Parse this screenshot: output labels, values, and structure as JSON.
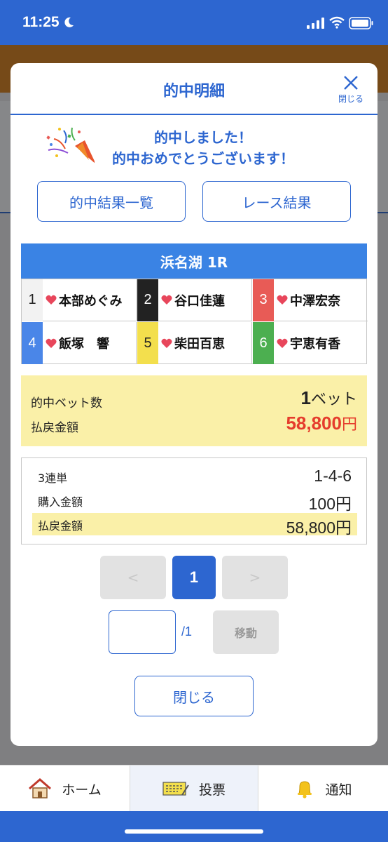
{
  "status_bar": {
    "time": "11:25"
  },
  "modal": {
    "title": "的中明細",
    "close_label": "閉じる",
    "congrats_line1": "的中しました！",
    "congrats_line2": "的中おめでとうございます！",
    "btn_results_list": "的中結果一覧",
    "btn_race_result": "レース結果",
    "race_title": "浜名湖 1R",
    "racers": [
      {
        "num": "1",
        "name": "本部めぐみ",
        "color": "#f2f2f2",
        "text_color": "#222"
      },
      {
        "num": "2",
        "name": "谷口佳蓮",
        "color": "#222222",
        "text_color": "#fff"
      },
      {
        "num": "3",
        "name": "中澤宏奈",
        "color": "#e85b56",
        "text_color": "#fff"
      },
      {
        "num": "4",
        "name": "飯塚　響",
        "color": "#4a86e8",
        "text_color": "#fff"
      },
      {
        "num": "5",
        "name": "柴田百恵",
        "color": "#f3df4d",
        "text_color": "#222"
      },
      {
        "num": "6",
        "name": "宇恵有香",
        "color": "#4caf50",
        "text_color": "#fff"
      }
    ],
    "summary": {
      "bets_label": "的中ベット数",
      "bets_value": "1",
      "bets_unit": "ベット",
      "payout_label": "払戻金額",
      "payout_value": "58,800",
      "payout_unit": "円"
    },
    "detail": {
      "type_label": "3連単",
      "type_value": "1-4-6",
      "purchase_label": "購入金額",
      "purchase_value": "100円",
      "payout_label": "払戻金額",
      "payout_value": "58,800円"
    },
    "pagination": {
      "prev": "<",
      "current": "1",
      "next": ">",
      "total": "/1",
      "move_label": "移動"
    },
    "close_button": "閉じる"
  },
  "tabbar": {
    "home": "ホーム",
    "vote": "投票",
    "notify": "通知"
  },
  "colors": {
    "primary": "#2d66d0",
    "red": "#e53c2c",
    "highlight": "#faf0a8"
  }
}
